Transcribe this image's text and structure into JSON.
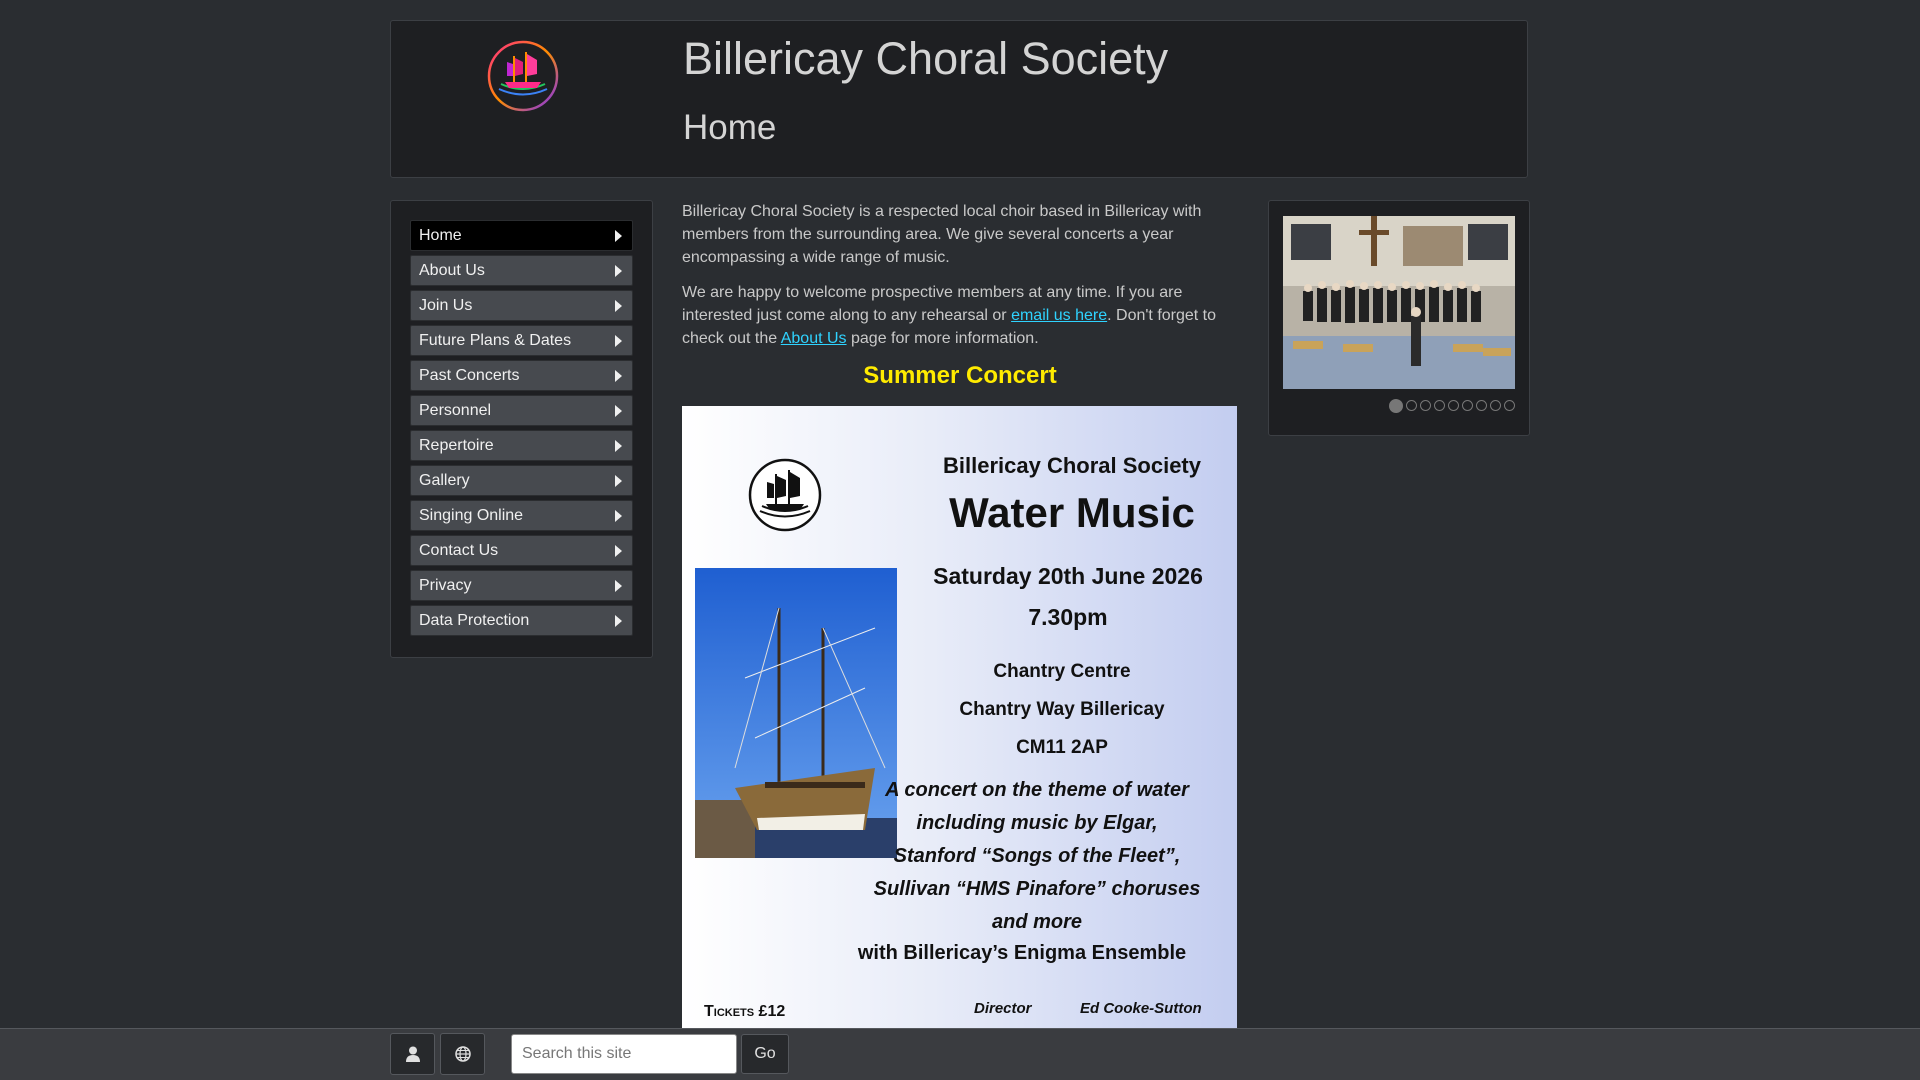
{
  "header": {
    "site_title": "Billericay Choral Society",
    "page_title": "Home"
  },
  "nav": {
    "items": [
      {
        "label": "Home",
        "active": true
      },
      {
        "label": "About Us"
      },
      {
        "label": "Join Us"
      },
      {
        "label": "Future Plans & Dates"
      },
      {
        "label": "Past Concerts"
      },
      {
        "label": "Personnel"
      },
      {
        "label": "Repertoire"
      },
      {
        "label": "Gallery"
      },
      {
        "label": "Singing Online"
      },
      {
        "label": "Contact Us"
      },
      {
        "label": "Privacy"
      },
      {
        "label": "Data Protection"
      }
    ]
  },
  "main": {
    "intro": "Billericay Choral Society is a respected local choir based in Billericay with members from the surrounding area. We give several concerts a year encompassing a wide range of music.",
    "welcome_before": "We are happy to welcome prospective members at any time. If you are interested just come along to any rehearsal or ",
    "email_link": "email us here",
    "welcome_middle": ". Don't forget to check out the ",
    "about_link": "About Us",
    "welcome_after": " page for more information.",
    "concert_heading": "Summer Concert"
  },
  "poster": {
    "society": "Billericay Choral Society",
    "title": "Water Music",
    "date": "Saturday 20th June 2026",
    "time": "7.30pm",
    "venue_line1": "Chantry Centre",
    "venue_line2": "Chantry Way  Billericay",
    "venue_line3": "CM11 2AP",
    "desc_line1": "A concert on the theme of water",
    "desc_line2": "including music by  Elgar,",
    "desc_line3": "Stanford  “Songs of the Fleet”,",
    "desc_line4": "Sullivan  “HMS Pinafore” choruses",
    "desc_line5": "and more",
    "ensemble": "with Billericay’s Enigma Ensemble",
    "tickets": "Tickets  £12",
    "director_label": "Director",
    "director_name": "Ed Cooke-Sutton"
  },
  "slideshow": {
    "slide_count": 9,
    "active_index": 0
  },
  "footer": {
    "user_icon": "user-icon",
    "globe_icon": "globe-icon",
    "search_placeholder": "Search this site",
    "go_label": "Go"
  },
  "colors": {
    "background": "#2a2d31",
    "panel": "#1e1f22",
    "link": "#2fd3ff",
    "heading_accent": "#ffeb00"
  }
}
